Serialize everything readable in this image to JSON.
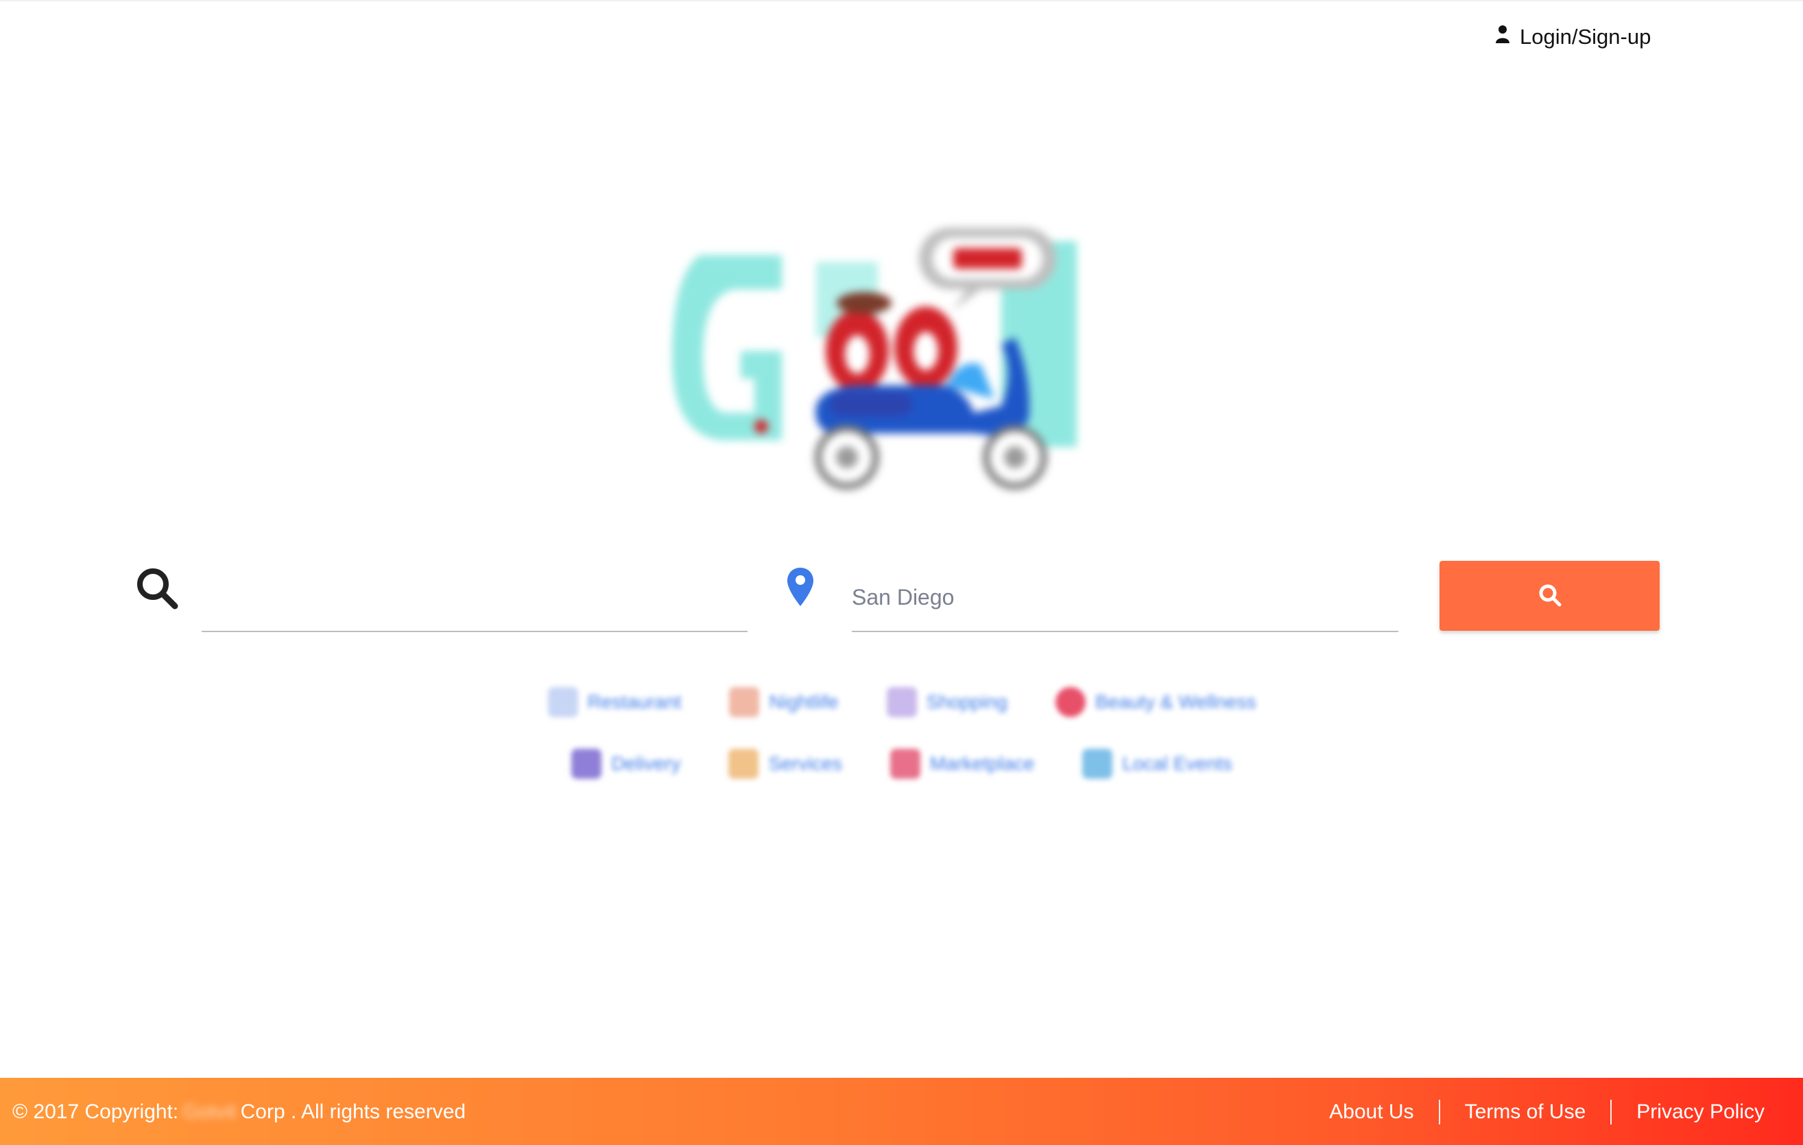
{
  "header": {
    "login_label": "Login/Sign-up",
    "login_icon": "user-icon"
  },
  "logo": {
    "icon": "scooter-logo",
    "colors": {
      "mint": "#8fe8e0",
      "red": "#d2232a",
      "blue": "#1e56c8",
      "light_blue": "#3fa9f5"
    }
  },
  "search": {
    "what_value": "",
    "where_value": "San Diego",
    "search_icon": "search-icon",
    "location_icon": "map-pin-icon",
    "button_icon": "search-icon",
    "button_color": "#ff6d41"
  },
  "categories": [
    {
      "label": "Restaurant",
      "icon": "utensils-icon"
    },
    {
      "label": "Nightlife",
      "icon": "cocktail-icon"
    },
    {
      "label": "Shopping",
      "icon": "shopping-bag-icon"
    },
    {
      "label": "Beauty & Wellness",
      "icon": "heart-icon"
    },
    {
      "label": "Delivery",
      "icon": "delivery-icon"
    },
    {
      "label": "Services",
      "icon": "services-icon"
    },
    {
      "label": "Marketplace",
      "icon": "store-icon"
    },
    {
      "label": "Local Events",
      "icon": "calendar-icon"
    }
  ],
  "footer": {
    "copyright_prefix": "© 2017 Copyright:",
    "brand": "Gotvit",
    "copyright_suffix": "Corp . All rights reserved",
    "links": {
      "about": "About Us",
      "terms": "Terms of Use",
      "privacy": "Privacy Policy"
    }
  }
}
